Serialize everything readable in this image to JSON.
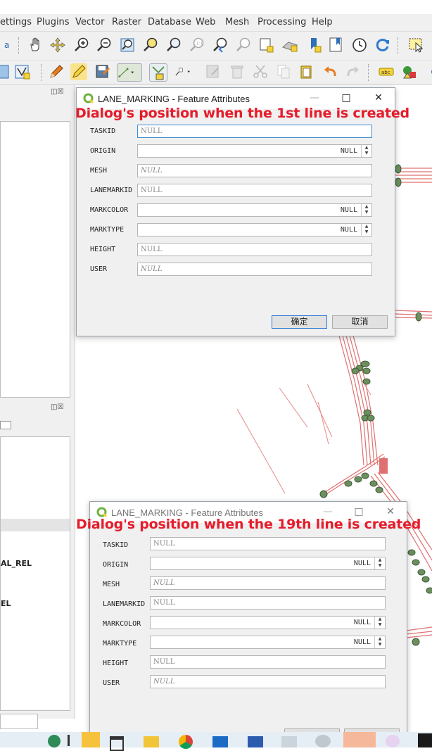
{
  "menu": [
    "ettings",
    "Plugins",
    "Vector",
    "Raster",
    "Database",
    "Web",
    "Mesh",
    "Processing",
    "Help"
  ],
  "tools_row1": [
    "select-icon",
    "pan-icon",
    "pan-to-selection-icon",
    "zoom-in-icon",
    "zoom-out-icon",
    "zoom-full-icon",
    "zoom-to-selection-icon",
    "zoom-to-layer-icon",
    "zoom-native-icon",
    "zoom-last-icon",
    "zoom-next-icon",
    "new-bookmark-icon",
    "show-bookmarks-icon",
    "temporal-icon",
    "refresh-icon",
    "select-features-icon"
  ],
  "tools_row2": [
    "edit-icon",
    "toggle-editing-icon",
    "save-edits-icon",
    "add-line-icon",
    "vertex-tool-icon",
    "modify-attributes-icon",
    "delete-icon",
    "cut-icon",
    "copy-icon",
    "paste-icon",
    "undo-icon",
    "redo-icon",
    "label-icon",
    "style-icon"
  ],
  "left_panel": {
    "label1": "AL_REL",
    "label2": "EL"
  },
  "dialog1": {
    "title": "LANE_MARKING - Feature Attributes",
    "fields": [
      {
        "label": "TASKID",
        "value": "NULL",
        "kind": "text",
        "style": "normal"
      },
      {
        "label": "ORIGIN",
        "value": "NULL",
        "kind": "spin"
      },
      {
        "label": "MESH",
        "value": "NULL",
        "kind": "text",
        "style": "italic"
      },
      {
        "label": "LANEMARKID",
        "value": "NULL",
        "kind": "text",
        "style": "normal"
      },
      {
        "label": "MARKCOLOR",
        "value": "NULL",
        "kind": "spin"
      },
      {
        "label": "MARKTYPE",
        "value": "NULL",
        "kind": "spin"
      },
      {
        "label": "HEIGHT",
        "value": "NULL",
        "kind": "text",
        "style": "normal"
      },
      {
        "label": "USER",
        "value": "NULL",
        "kind": "text",
        "style": "italic"
      }
    ],
    "ok": "确定",
    "cancel": "取消"
  },
  "dialog2": {
    "title": "LANE_MARKING - Feature Attributes",
    "fields": [
      {
        "label": "TASKID",
        "value": "NULL",
        "kind": "text",
        "style": "normal"
      },
      {
        "label": "ORIGIN",
        "value": "NULL",
        "kind": "spin"
      },
      {
        "label": "MESH",
        "value": "NULL",
        "kind": "text",
        "style": "italic"
      },
      {
        "label": "LANEMARKID",
        "value": "NULL",
        "kind": "text",
        "style": "normal"
      },
      {
        "label": "MARKCOLOR",
        "value": "NULL",
        "kind": "spin"
      },
      {
        "label": "MARKTYPE",
        "value": "NULL",
        "kind": "spin"
      },
      {
        "label": "HEIGHT",
        "value": "NULL",
        "kind": "text",
        "style": "normal"
      },
      {
        "label": "USER",
        "value": "NULL",
        "kind": "text",
        "style": "italic"
      }
    ]
  },
  "annotations": {
    "first": "Dialog's position when the 1st line is created",
    "second": "Dialog's position when the 19th line is created"
  },
  "colors": {
    "accent": "#e51c2b",
    "road": "#e07070",
    "node": "#6b8f5e",
    "qgis": "#6fb23e"
  }
}
